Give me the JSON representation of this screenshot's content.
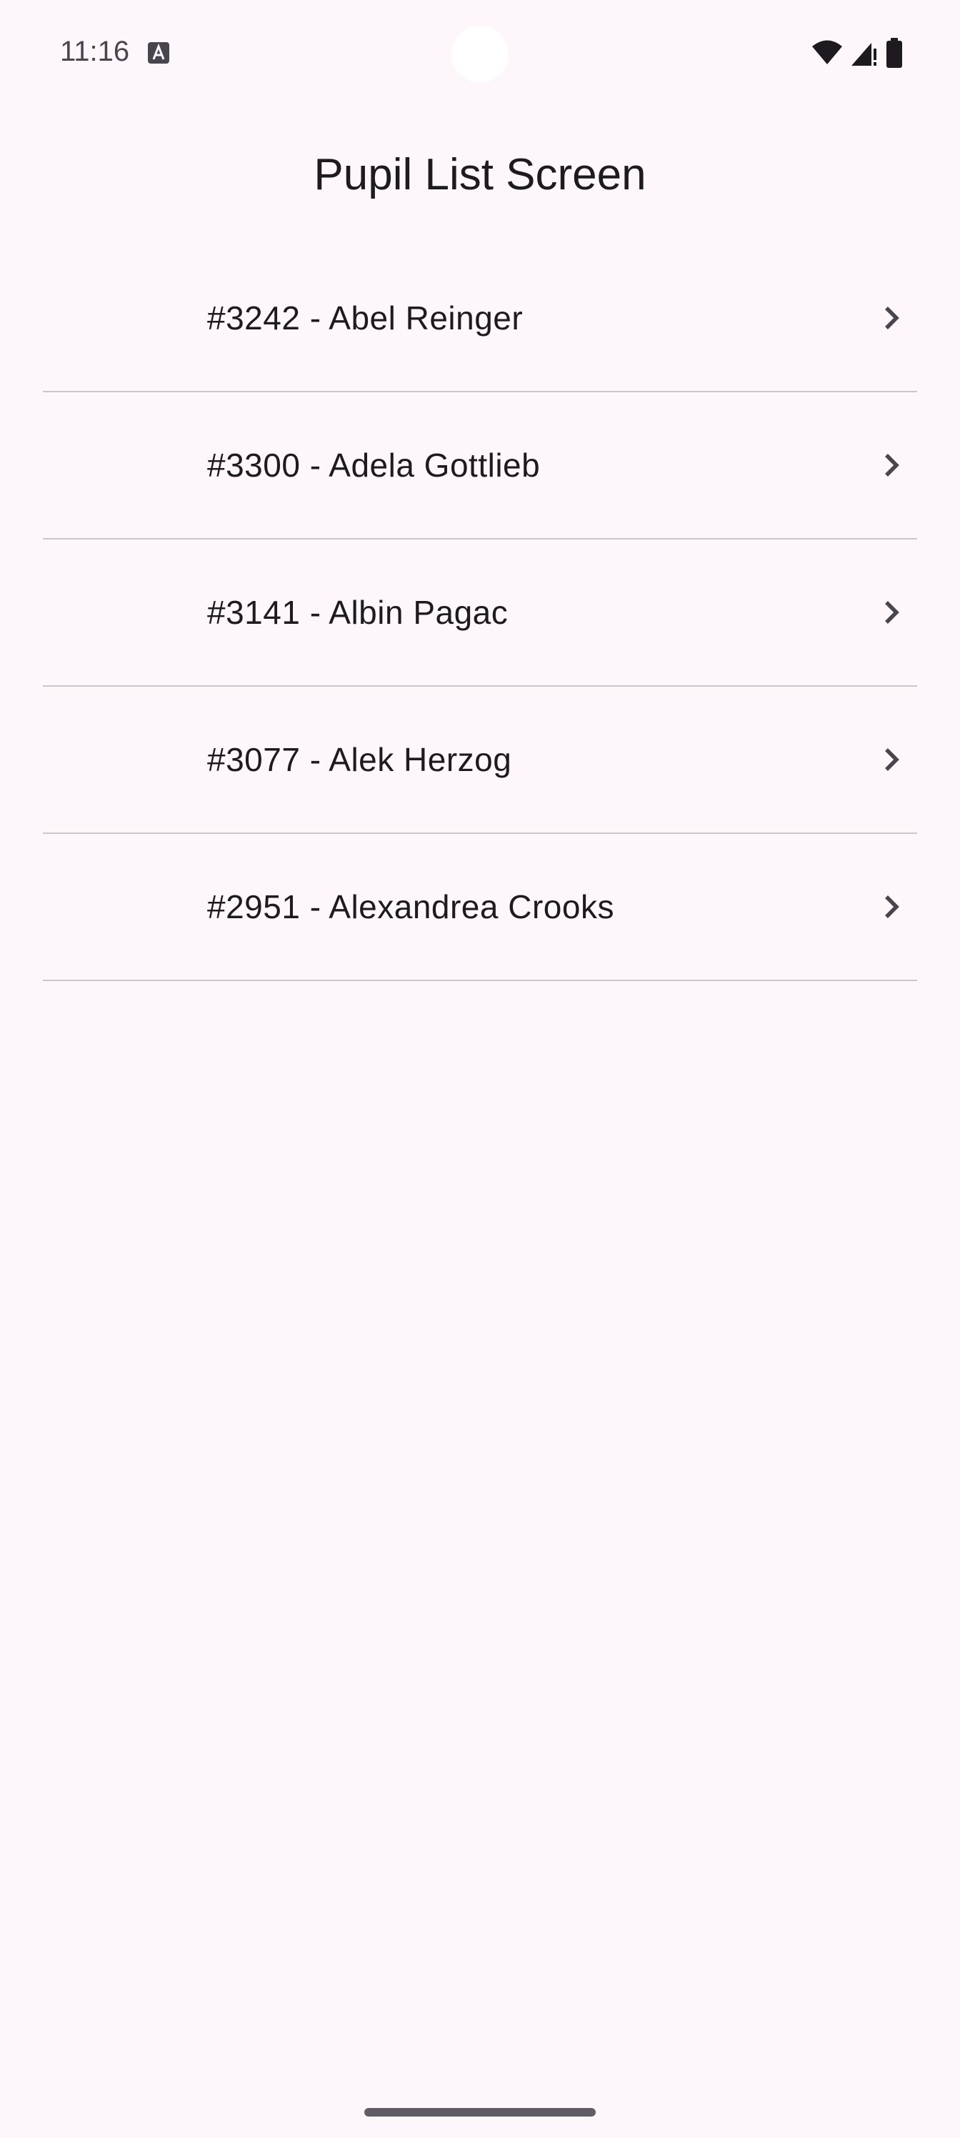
{
  "status_bar": {
    "time": "11:16",
    "left_icon": "a-notification-icon",
    "right_icons": [
      "wifi-icon",
      "cellular-signal-icon",
      "battery-icon"
    ]
  },
  "header": {
    "title": "Pupil List Screen"
  },
  "pupils": [
    {
      "label": "#3242 - Abel Reinger"
    },
    {
      "label": "#3300 - Adela Gottlieb"
    },
    {
      "label": "#3141 - Albin Pagac"
    },
    {
      "label": "#3077 - Alek Herzog"
    },
    {
      "label": "#2951 - Alexandrea Crooks"
    }
  ],
  "colors": {
    "background": "#fdf7fc",
    "text": "#1d1b20",
    "divider": "#cac4d0",
    "icon": "#49454f"
  }
}
